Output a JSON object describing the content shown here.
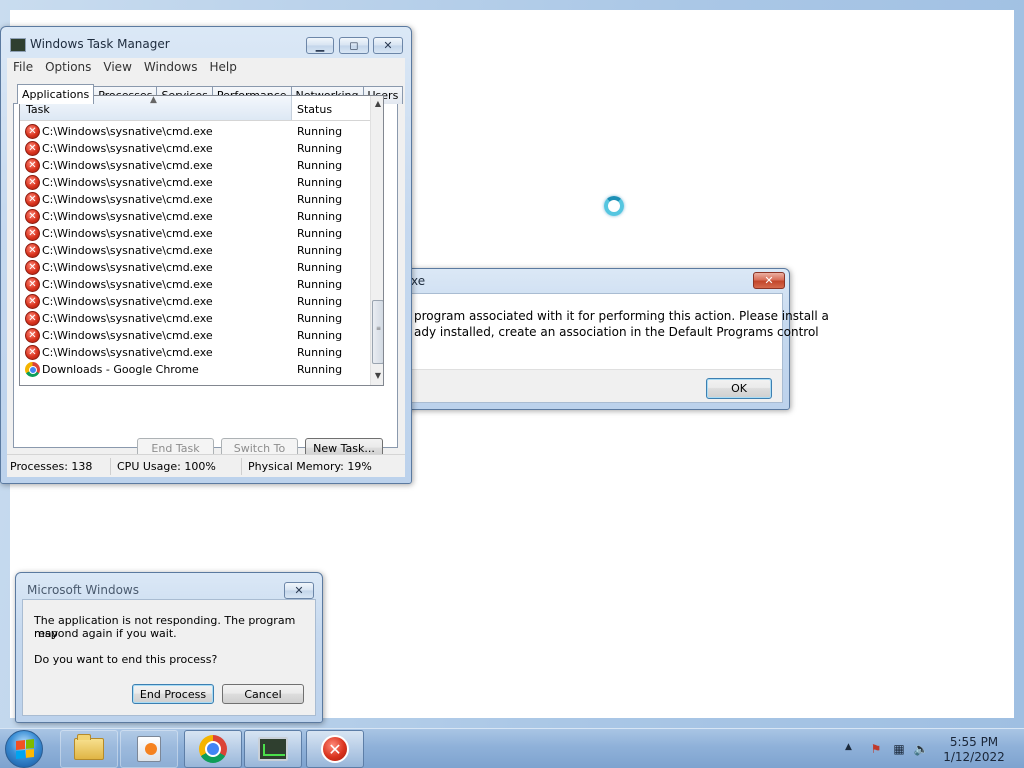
{
  "task_manager": {
    "title": "Windows Task Manager",
    "menu": [
      "File",
      "Options",
      "View",
      "Windows",
      "Help"
    ],
    "tabs": [
      "Applications",
      "Processes",
      "Services",
      "Performance",
      "Networking",
      "Users"
    ],
    "active_tab": "Applications",
    "columns": {
      "task": "Task",
      "status": "Status"
    },
    "rows": [
      {
        "name": "C:\\Windows\\sysnative\\cmd.exe",
        "status": "Running",
        "icon": "error-icon"
      },
      {
        "name": "C:\\Windows\\sysnative\\cmd.exe",
        "status": "Running",
        "icon": "error-icon"
      },
      {
        "name": "C:\\Windows\\sysnative\\cmd.exe",
        "status": "Running",
        "icon": "error-icon"
      },
      {
        "name": "C:\\Windows\\sysnative\\cmd.exe",
        "status": "Running",
        "icon": "error-icon"
      },
      {
        "name": "C:\\Windows\\sysnative\\cmd.exe",
        "status": "Running",
        "icon": "error-icon"
      },
      {
        "name": "C:\\Windows\\sysnative\\cmd.exe",
        "status": "Running",
        "icon": "error-icon"
      },
      {
        "name": "C:\\Windows\\sysnative\\cmd.exe",
        "status": "Running",
        "icon": "error-icon"
      },
      {
        "name": "C:\\Windows\\sysnative\\cmd.exe",
        "status": "Running",
        "icon": "error-icon"
      },
      {
        "name": "C:\\Windows\\sysnative\\cmd.exe",
        "status": "Running",
        "icon": "error-icon"
      },
      {
        "name": "C:\\Windows\\sysnative\\cmd.exe",
        "status": "Running",
        "icon": "error-icon"
      },
      {
        "name": "C:\\Windows\\sysnative\\cmd.exe",
        "status": "Running",
        "icon": "error-icon"
      },
      {
        "name": "C:\\Windows\\sysnative\\cmd.exe",
        "status": "Running",
        "icon": "error-icon"
      },
      {
        "name": "C:\\Windows\\sysnative\\cmd.exe",
        "status": "Running",
        "icon": "error-icon"
      },
      {
        "name": "C:\\Windows\\sysnative\\cmd.exe",
        "status": "Running",
        "icon": "error-icon"
      },
      {
        "name": "Downloads - Google Chrome",
        "status": "Running",
        "icon": "chrome-icon"
      }
    ],
    "buttons": {
      "end_task": "End Task",
      "switch_to": "Switch To",
      "new_task": "New Task..."
    },
    "statusbar": {
      "processes": "Processes: 138",
      "cpu": "CPU Usage: 100%",
      "memory": "Physical Memory: 19%"
    }
  },
  "error_dialog": {
    "title_fragment": "xe",
    "line1": "program associated with it for performing this action. Please install a",
    "line2": "ady installed, create an association in the Default Programs control",
    "ok_label": "OK"
  },
  "not_responding_dialog": {
    "title": "Microsoft Windows",
    "message_line1": "The application is not responding. The program may",
    "message_line2": "respond again if you wait.",
    "question": "Do you want to end this process?",
    "end_process_label": "End Process",
    "cancel_label": "Cancel"
  },
  "taskbar": {
    "apps": [
      "windows-explorer",
      "windows-media-player",
      "google-chrome",
      "task-manager",
      "error-app"
    ],
    "clock_time": "5:55 PM",
    "clock_date": "1/12/2022"
  },
  "colors": {
    "titlebar": "#c6d9ef",
    "taskbar": "#8fb1d9",
    "error_red": "#d9331e"
  }
}
